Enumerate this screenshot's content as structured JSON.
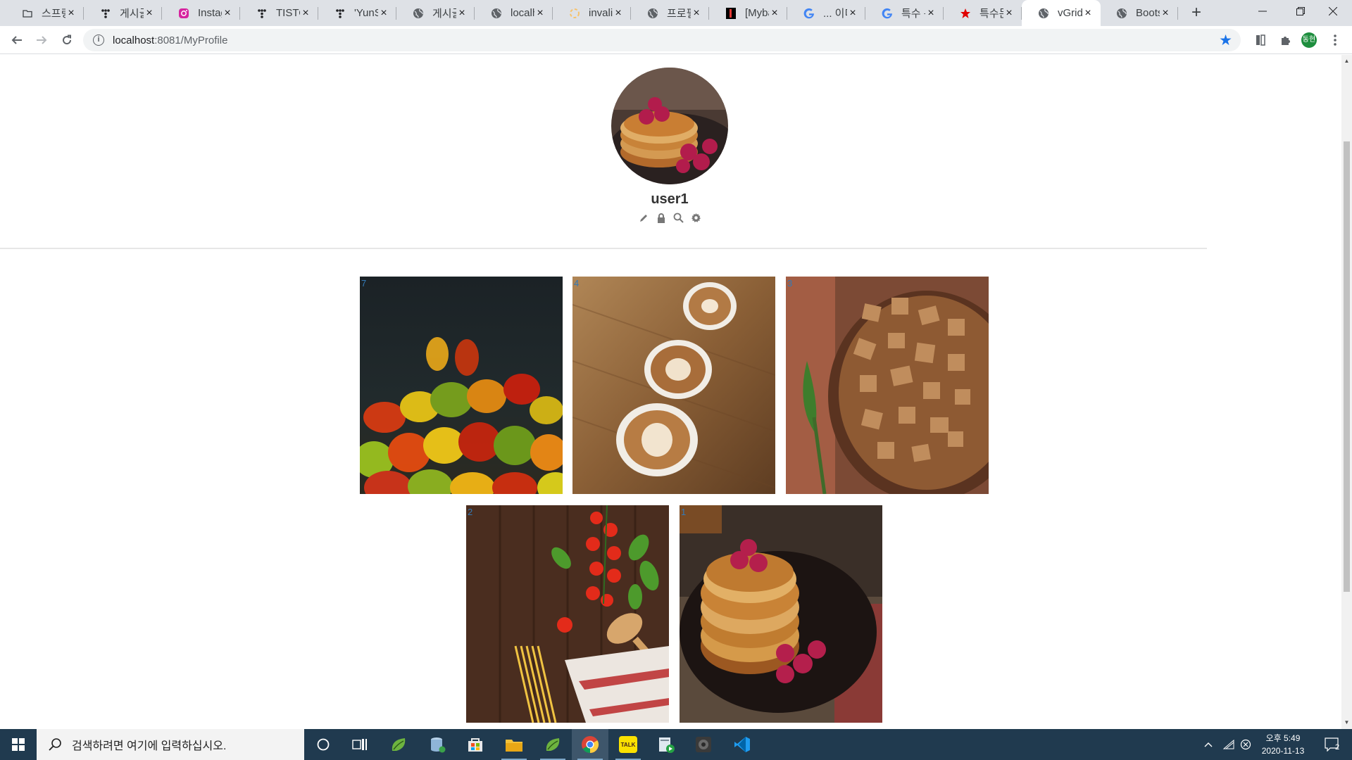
{
  "browser": {
    "tabs": [
      {
        "title": "스프링",
        "icon": "folder-icon"
      },
      {
        "title": "게시글",
        "icon": "tistory-icon"
      },
      {
        "title": "Instag",
        "icon": "instagram-icon"
      },
      {
        "title": "TISTOF",
        "icon": "tistory-icon"
      },
      {
        "title": "'YunSc",
        "icon": "tistory-icon"
      },
      {
        "title": "게시글",
        "icon": "globe-icon"
      },
      {
        "title": "localhc",
        "icon": "globe-icon"
      },
      {
        "title": "invalid",
        "icon": "loading-icon"
      },
      {
        "title": "프로필",
        "icon": "globe-icon"
      },
      {
        "title": "[Myba",
        "icon": "blog-icon"
      },
      {
        "title": "... 이미",
        "icon": "google-icon"
      },
      {
        "title": "특수 문",
        "icon": "google-icon"
      },
      {
        "title": "특수문",
        "icon": "star-icon"
      },
      {
        "title": "vGrid",
        "icon": "globe-icon",
        "active": true
      },
      {
        "title": "Bootst",
        "icon": "globe-icon"
      }
    ],
    "url_host": "localhost",
    "url_path": ":8081/MyProfile",
    "profile_initial": "동현"
  },
  "profile": {
    "username": "user1",
    "actions": [
      "pencil-icon",
      "lock-icon",
      "search-icon",
      "gear-icon"
    ]
  },
  "posts": [
    {
      "number": "7",
      "subject": "gummy bears"
    },
    {
      "number": "4",
      "subject": "coffee cups"
    },
    {
      "number": "3",
      "subject": "croutons"
    },
    {
      "number": "2",
      "subject": "tomatoes and pasta"
    },
    {
      "number": "1",
      "subject": "pancakes"
    }
  ],
  "taskbar": {
    "search_placeholder": "검색하려면 여기에 입력하십시오.",
    "time": "오후 5:49",
    "date": "2020-11-13",
    "notification_count": "2",
    "kakao_label": "TALK"
  },
  "colors": {
    "tabstrip": "#dee1e6",
    "accent": "#1a73e8",
    "taskbar": "#203a4f",
    "post_number": "#337ab7"
  }
}
